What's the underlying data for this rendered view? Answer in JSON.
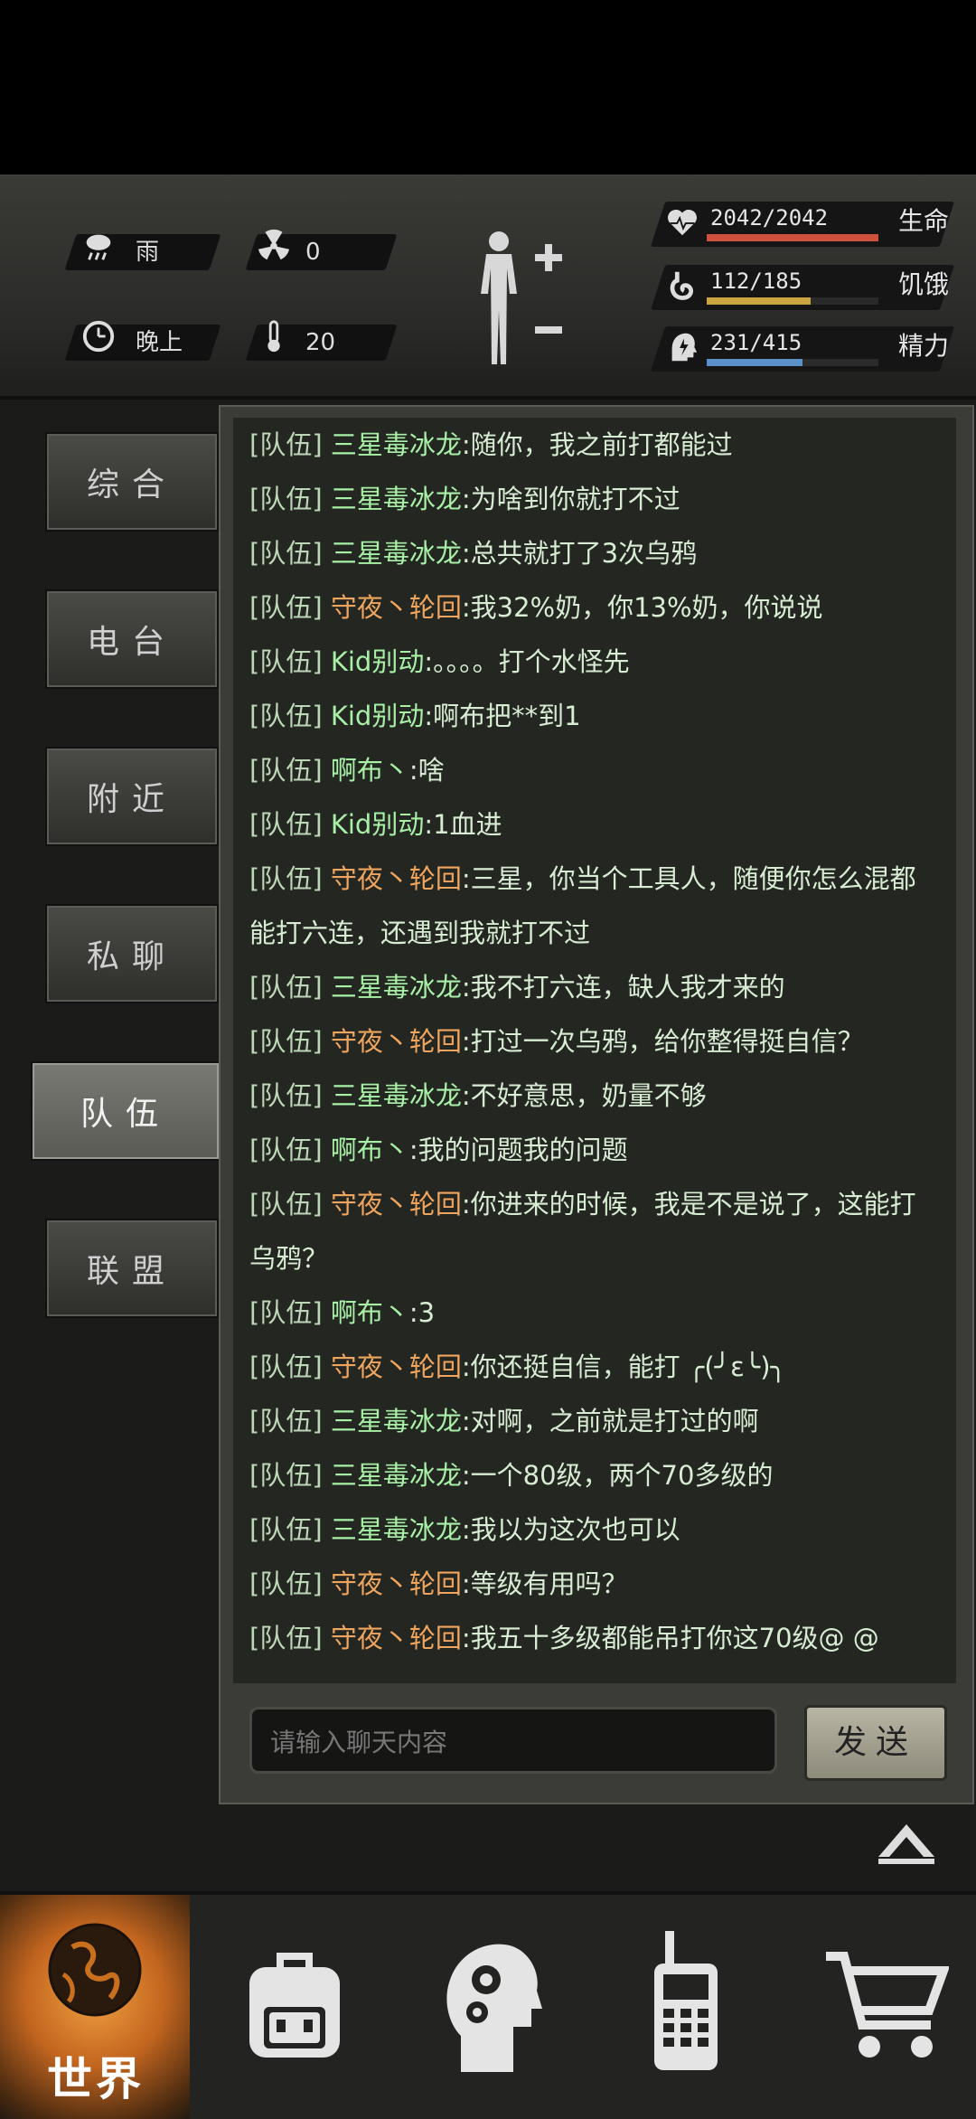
{
  "hud": {
    "weather": "雨",
    "radiation": "0",
    "time_of_day": "晚上",
    "temperature": "20",
    "stats": [
      {
        "value": "2042/2042",
        "label": "生命",
        "fill": 1.0,
        "color": "#d0503e"
      },
      {
        "value": "112/185",
        "label": "饥饿",
        "fill": 0.605,
        "color": "#c9a43f"
      },
      {
        "value": "231/415",
        "label": "精力",
        "fill": 0.557,
        "color": "#5a8fc8"
      }
    ]
  },
  "tabs": [
    {
      "label": "综合"
    },
    {
      "label": "电台"
    },
    {
      "label": "附近"
    },
    {
      "label": "私聊"
    },
    {
      "label": "队伍",
      "active": true
    },
    {
      "label": "联盟"
    }
  ],
  "messages": [
    {
      "tag": "[队伍]",
      "name": "三星毒冰龙",
      "text": ":随你，我之前打都能过",
      "name_color": "green"
    },
    {
      "tag": "[队伍]",
      "name": "三星毒冰龙",
      "text": ":为啥到你就打不过",
      "name_color": "green"
    },
    {
      "tag": "[队伍]",
      "name": "三星毒冰龙",
      "text": ":总共就打了3次乌鸦",
      "name_color": "green"
    },
    {
      "tag": "[队伍]",
      "name": "守夜丶轮回",
      "text": ":我32%奶，你13%奶，你说说",
      "name_color": "orange"
    },
    {
      "tag": "[队伍]",
      "name": "Kid别动",
      "text": ":。。。。打个水怪先",
      "name_color": "green"
    },
    {
      "tag": "[队伍]",
      "name": "Kid别动",
      "text": ":啊布把**到1",
      "name_color": "green"
    },
    {
      "tag": "[队伍]",
      "name": "啊布丶",
      "text": ":啥",
      "name_color": "green"
    },
    {
      "tag": "[队伍]",
      "name": "Kid别动",
      "text": ":1血进",
      "name_color": "green"
    },
    {
      "tag": "[队伍]",
      "name": "守夜丶轮回",
      "text": ":三星，你当个工具人，随便你怎么混都能打六连，还遇到我就打不过",
      "name_color": "orange"
    },
    {
      "tag": "[队伍]",
      "name": "三星毒冰龙",
      "text": ":我不打六连，缺人我才来的",
      "name_color": "green"
    },
    {
      "tag": "[队伍]",
      "name": "守夜丶轮回",
      "text": ":打过一次乌鸦，给你整得挺自信？",
      "name_color": "orange"
    },
    {
      "tag": "[队伍]",
      "name": "三星毒冰龙",
      "text": ":不好意思，奶量不够",
      "name_color": "green"
    },
    {
      "tag": "[队伍]",
      "name": "啊布丶",
      "text": ":我的问题我的问题",
      "name_color": "green"
    },
    {
      "tag": "[队伍]",
      "name": "守夜丶轮回",
      "text": ":你进来的时候，我是不是说了，这能打乌鸦？",
      "name_color": "orange"
    },
    {
      "tag": "[队伍]",
      "name": "啊布丶",
      "text": ":3",
      "name_color": "green"
    },
    {
      "tag": "[队伍]",
      "name": "守夜丶轮回",
      "text": ":你还挺自信，能打 ╭(╯ε╰)╮",
      "name_color": "orange"
    },
    {
      "tag": "[队伍]",
      "name": "三星毒冰龙",
      "text": ":对啊，之前就是打过的啊",
      "name_color": "green"
    },
    {
      "tag": "[队伍]",
      "name": "三星毒冰龙",
      "text": ":一个80级，两个70多级的",
      "name_color": "green"
    },
    {
      "tag": "[队伍]",
      "name": "三星毒冰龙",
      "text": ":我以为这次也可以",
      "name_color": "green"
    },
    {
      "tag": "[队伍]",
      "name": "守夜丶轮回",
      "text": ":等级有用吗？",
      "name_color": "orange"
    },
    {
      "tag": "[队伍]",
      "name": "守夜丶轮回",
      "text": ":我五十多级都能吊打你这70级@ @",
      "name_color": "orange"
    }
  ],
  "input": {
    "placeholder": "请输入聊天内容",
    "value": ""
  },
  "send_label": "发送",
  "bottom_nav": [
    {
      "label": "世界",
      "icon": "globe-icon"
    },
    {
      "label": "",
      "icon": "backpack-icon"
    },
    {
      "label": "",
      "icon": "head-gears-icon"
    },
    {
      "label": "",
      "icon": "radio-icon"
    },
    {
      "label": "",
      "icon": "cart-icon"
    }
  ]
}
